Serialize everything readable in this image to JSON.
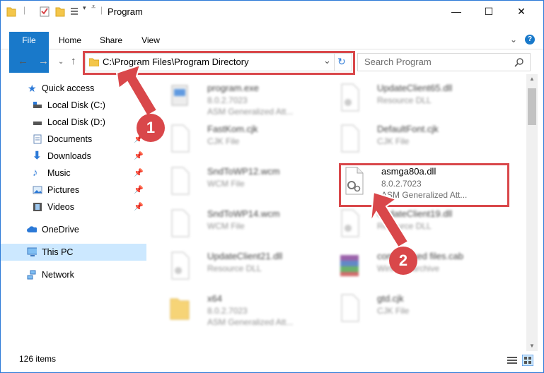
{
  "window": {
    "title": "Program",
    "controls": {
      "minimize": "—",
      "maximize": "☐",
      "close": "✕"
    }
  },
  "ribbon": {
    "tabs": [
      "File",
      "Home",
      "Share",
      "View"
    ],
    "expand_icon": "chevron-down-icon",
    "help_icon": "?"
  },
  "navigation": {
    "address": "C:\\Program Files\\Program Directory",
    "search_placeholder": "Search Program"
  },
  "sidebar": {
    "items": [
      {
        "label": "Quick access",
        "icon": "star-icon"
      },
      {
        "label": "Local Disk (C:)",
        "icon": "drive-icon"
      },
      {
        "label": "Local Disk (D:)",
        "icon": "drive-icon"
      },
      {
        "label": "Documents",
        "icon": "documents-icon",
        "pinned": true
      },
      {
        "label": "Downloads",
        "icon": "download-icon",
        "pinned": true
      },
      {
        "label": "Music",
        "icon": "music-icon",
        "pinned": true
      },
      {
        "label": "Pictures",
        "icon": "pictures-icon",
        "pinned": true
      },
      {
        "label": "Videos",
        "icon": "videos-icon",
        "pinned": true
      },
      {
        "label": "OneDrive",
        "icon": "cloud-icon"
      },
      {
        "label": "This PC",
        "icon": "computer-icon",
        "selected": true
      },
      {
        "label": "Network",
        "icon": "network-icon"
      }
    ]
  },
  "files": [
    {
      "name": "program.exe",
      "version": "8.0.2.7023",
      "desc": "ASM Generalized Att...",
      "icon": "exe-icon"
    },
    {
      "name": "UpdateClient65.dll",
      "type": "Resource DLL",
      "icon": "dll-icon"
    },
    {
      "name": "FastKom.cjk",
      "type": "CJK File",
      "icon": "file-icon"
    },
    {
      "name": "DefaultFont.cjk",
      "type": "CJK File",
      "icon": "file-icon"
    },
    {
      "name": "SndToWP12.wcm",
      "type": "WCM File",
      "icon": "file-icon"
    },
    {
      "name": "asmga80a.dll",
      "version": "8.0.2.7023",
      "desc": "ASM Generalized Att...",
      "icon": "dll-icon"
    },
    {
      "name": "SndToWP14.wcm",
      "type": "WCM File",
      "icon": "file-icon"
    },
    {
      "name": "UpdateClient19.dll",
      "type": "Resource DLL",
      "icon": "dll-icon"
    },
    {
      "name": "UpdateClient21.dll",
      "type": "Resource DLL",
      "icon": "dll-icon"
    },
    {
      "name": "compressed files.cab",
      "type": "WinRAR archive",
      "icon": "archive-icon"
    },
    {
      "name": "x64",
      "version": "8.0.2.7023",
      "desc": "ASM Generalized Att...",
      "icon": "folder-icon"
    },
    {
      "name": "gtd.cjk",
      "type": "CJK File",
      "icon": "file-icon"
    }
  ],
  "status": {
    "count": "126 items"
  },
  "annotations": {
    "step1": "1",
    "step2": "2"
  },
  "colors": {
    "accent": "#1979ca",
    "highlight": "#d9474a",
    "selected": "#cce8ff"
  }
}
